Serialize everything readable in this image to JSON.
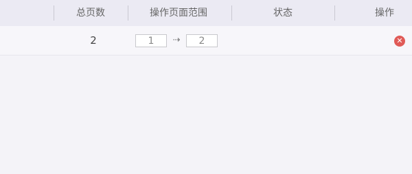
{
  "table": {
    "columns": {
      "total_pages": "总页数",
      "page_range": "操作页面范围",
      "status": "状态",
      "actions": "操作"
    },
    "rows": [
      {
        "total_pages": "2",
        "range_from": "1",
        "range_arrow": "⇢",
        "range_to": "2",
        "status": "",
        "remove_icon": "✕"
      }
    ]
  },
  "colors": {
    "header_bg": "#ebeaf3",
    "row_bg": "#f7f6fa",
    "remove_button": "#e05a57"
  }
}
